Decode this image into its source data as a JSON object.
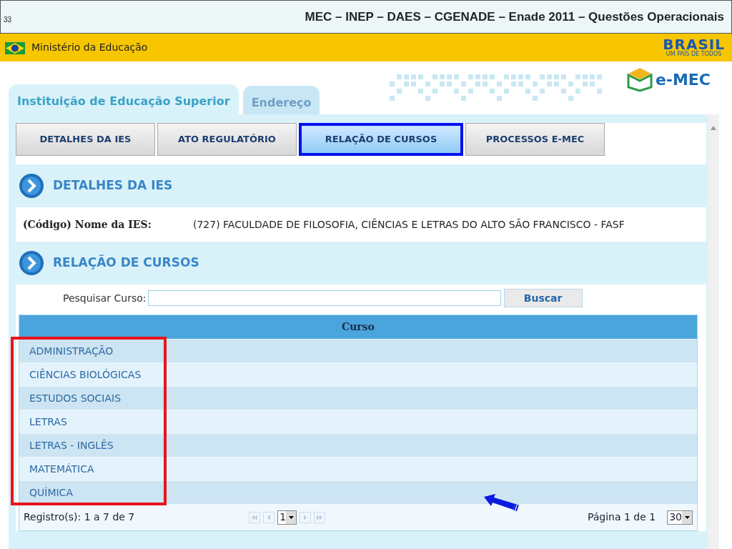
{
  "slide": {
    "number": "33",
    "title": "MEC – INEP – DAES – CGENADE – Enade 2011 – Questões Operacionais"
  },
  "banner": {
    "ministry": "Ministério da Educação",
    "brand": "BRASIL",
    "tagline": "UM PAÍS DE TODOS"
  },
  "outer_tabs": [
    {
      "label": "Instituição de Educação Superior",
      "selected": true
    },
    {
      "label": "Endereço",
      "selected": false
    }
  ],
  "logo": {
    "text": "e-MEC"
  },
  "nav_tabs": [
    {
      "label": "DETALHES DA IES",
      "selected": false
    },
    {
      "label": "ATO REGULATÓRIO",
      "selected": false
    },
    {
      "label": "RELAÇÃO DE CURSOS",
      "selected": true
    },
    {
      "label": "PROCESSOS E-MEC",
      "selected": false
    }
  ],
  "details": {
    "title": "DETALHES DA IES",
    "field_label": "(Código) Nome da IES:",
    "field_value": "(727) FACULDADE DE FILOSOFIA, CIÊNCIAS E LETRAS DO ALTO SÃO FRANCISCO - FASF"
  },
  "courses": {
    "title": "RELAÇÃO DE CURSOS",
    "search_label": "Pesquisar Curso:",
    "search_button": "Buscar",
    "column": "Curso",
    "rows": [
      "ADMINISTRAÇÃO",
      "CIÊNCIAS BIOLÓGICAS",
      "ESTUDOS SOCIAIS",
      "LETRAS",
      "LETRAS - INGLÊS",
      "MATEMÁTICA",
      "QUÍMICA"
    ],
    "records": "Registro(s): 1 a 7 de 7",
    "page": "1",
    "page_info": "Página 1 de 1",
    "page_size": "30"
  }
}
